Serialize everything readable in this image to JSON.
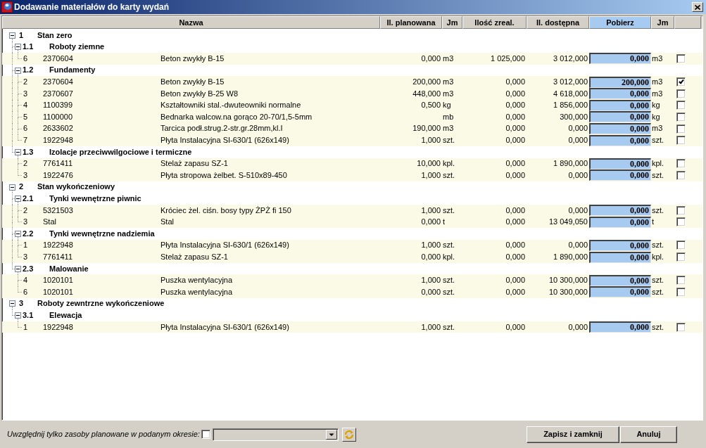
{
  "window": {
    "title": "Dodawanie materiałów do karty wydań"
  },
  "table": {
    "columns": [
      {
        "label": "Nazwa",
        "highlighted": false
      },
      {
        "label": "Il. planowana",
        "highlighted": false
      },
      {
        "label": "Jm",
        "highlighted": false
      },
      {
        "label": "Ilość zreal.",
        "highlighted": false
      },
      {
        "label": "Il. dostępna",
        "highlighted": false
      },
      {
        "label": "Pobierz",
        "highlighted": true
      },
      {
        "label": "Jm",
        "highlighted": false
      }
    ],
    "tree": [
      {
        "number": "1",
        "name": "Stan zero",
        "expanded": true,
        "children": [
          {
            "number": "1.1",
            "name": "Roboty ziemne",
            "expanded": true,
            "children": [
              {
                "number": "6",
                "code": "2370604",
                "name": "Beton zwykły B-15",
                "planned": "0,000",
                "planned_unit": "m3",
                "realized": "1 025,000",
                "available": "3 012,000",
                "take": "0,000",
                "take_unit": "m3",
                "checked": false
              }
            ]
          },
          {
            "number": "1.2",
            "name": "Fundamenty",
            "expanded": true,
            "children": [
              {
                "number": "2",
                "code": "2370604",
                "name": "Beton zwykły B-15",
                "planned": "200,000",
                "planned_unit": "m3",
                "realized": "0,000",
                "available": "3 012,000",
                "take": "200,000",
                "take_unit": "m3",
                "checked": true
              },
              {
                "number": "3",
                "code": "2370607",
                "name": "Beton zwykły B-25 W8",
                "planned": "448,000",
                "planned_unit": "m3",
                "realized": "0,000",
                "available": "4 618,000",
                "take": "0,000",
                "take_unit": "m3",
                "checked": false
              },
              {
                "number": "4",
                "code": "1100399",
                "name": "Kształtowniki stal.-dwuteowniki normalne",
                "planned": "0,500",
                "planned_unit": "kg",
                "realized": "0,000",
                "available": "1 856,000",
                "take": "0,000",
                "take_unit": "kg",
                "checked": false
              },
              {
                "number": "5",
                "code": "1100000",
                "name": "Bednarka walcow.na gorąco 20-70/1,5-5mm",
                "planned_unit": "mb",
                "realized": "0,000",
                "available": "300,000",
                "take": "0,000",
                "take_unit": "kg",
                "checked": false
              },
              {
                "number": "6",
                "code": "2633602",
                "name": "Tarcica podł.strug.2-str.gr.28mm,kl.I",
                "planned": "190,000",
                "planned_unit": "m3",
                "realized": "0,000",
                "available": "0,000",
                "take": "0,000",
                "take_unit": "m3",
                "checked": false
              },
              {
                "number": "7",
                "code": "1922948",
                "name": "Płyta Instalacyjna SI-630/1 (626x149)",
                "planned": "1,000",
                "planned_unit": "szt.",
                "realized": "0,000",
                "available": "0,000",
                "take": "0,000",
                "take_unit": "szt.",
                "checked": false
              }
            ]
          },
          {
            "number": "1.3",
            "name": "Izolacje przeciwwilgociowe i termiczne",
            "expanded": true,
            "children": [
              {
                "number": "2",
                "code": "7761411",
                "name": "Stelaż zapasu SZ-1",
                "planned": "10,000",
                "planned_unit": "kpl.",
                "realized": "0,000",
                "available": "1 890,000",
                "take": "0,000",
                "take_unit": "kpl.",
                "checked": false
              },
              {
                "number": "3",
                "code": "1922476",
                "name": "Płyta stropowa żelbet. S-510x89-450",
                "planned": "1,000",
                "planned_unit": "szt.",
                "realized": "0,000",
                "available": "0,000",
                "take": "0,000",
                "take_unit": "szt.",
                "checked": false
              }
            ]
          }
        ]
      },
      {
        "number": "2",
        "name": "Stan wykończeniowy",
        "expanded": true,
        "children": [
          {
            "number": "2.1",
            "name": "Tynki wewnętrzne piwnic",
            "expanded": true,
            "children": [
              {
                "number": "2",
                "code": "5321503",
                "name": "Króciec żel. ciśn. bosy typy ŻPŻ fi 150",
                "planned": "1,000",
                "planned_unit": "szt.",
                "realized": "0,000",
                "available": "0,000",
                "take": "0,000",
                "take_unit": "szt.",
                "checked": false
              },
              {
                "number": "3",
                "code": "Stal",
                "name": "Stal",
                "planned": "0,000",
                "planned_unit": "t",
                "realized": "0,000",
                "available": "13 049,050",
                "take": "0,000",
                "take_unit": "t",
                "checked": false
              }
            ]
          },
          {
            "number": "2.2",
            "name": "Tynki wewnętrzne nadziemia",
            "expanded": true,
            "children": [
              {
                "number": "1",
                "code": "1922948",
                "name": "Płyta Instalacyjna SI-630/1 (626x149)",
                "planned": "1,000",
                "planned_unit": "szt.",
                "realized": "0,000",
                "available": "0,000",
                "take": "0,000",
                "take_unit": "szt.",
                "checked": false
              },
              {
                "number": "3",
                "code": "7761411",
                "name": "Stelaż zapasu SZ-1",
                "planned": "0,000",
                "planned_unit": "kpl.",
                "realized": "0,000",
                "available": "1 890,000",
                "take": "0,000",
                "take_unit": "kpl.",
                "checked": false
              }
            ]
          },
          {
            "number": "2.3",
            "name": "Malowanie",
            "expanded": true,
            "children": [
              {
                "number": "4",
                "code": "1020101",
                "name": "Puszka wentylacyjna",
                "planned": "1,000",
                "planned_unit": "szt.",
                "realized": "0,000",
                "available": "10 300,000",
                "take": "0,000",
                "take_unit": "szt.",
                "checked": false
              },
              {
                "number": "6",
                "code": "1020101",
                "name": "Puszka wentylacyjna",
                "planned": "0,000",
                "planned_unit": "szt.",
                "realized": "0,000",
                "available": "10 300,000",
                "take": "0,000",
                "take_unit": "szt.",
                "checked": false
              }
            ]
          }
        ]
      },
      {
        "number": "3",
        "name": "Roboty zewntrzne wykończeniowe",
        "expanded": true,
        "children": [
          {
            "number": "3.1",
            "name": "Elewacja",
            "expanded": true,
            "children": [
              {
                "number": "1",
                "code": "1922948",
                "name": "Płyta Instalacyjna SI-630/1 (626x149)",
                "planned": "1,000",
                "planned_unit": "szt.",
                "realized": "0,000",
                "available": "0,000",
                "take": "0,000",
                "take_unit": "szt.",
                "checked": false
              }
            ]
          }
        ]
      }
    ]
  },
  "filter": {
    "label": "Uwzględnij tylko zasoby planowane w podanym okresie:",
    "checked": false,
    "period_select": {
      "disabled": true
    }
  },
  "buttons": [
    "Zapisz i zamknij",
    "Anuluj"
  ]
}
